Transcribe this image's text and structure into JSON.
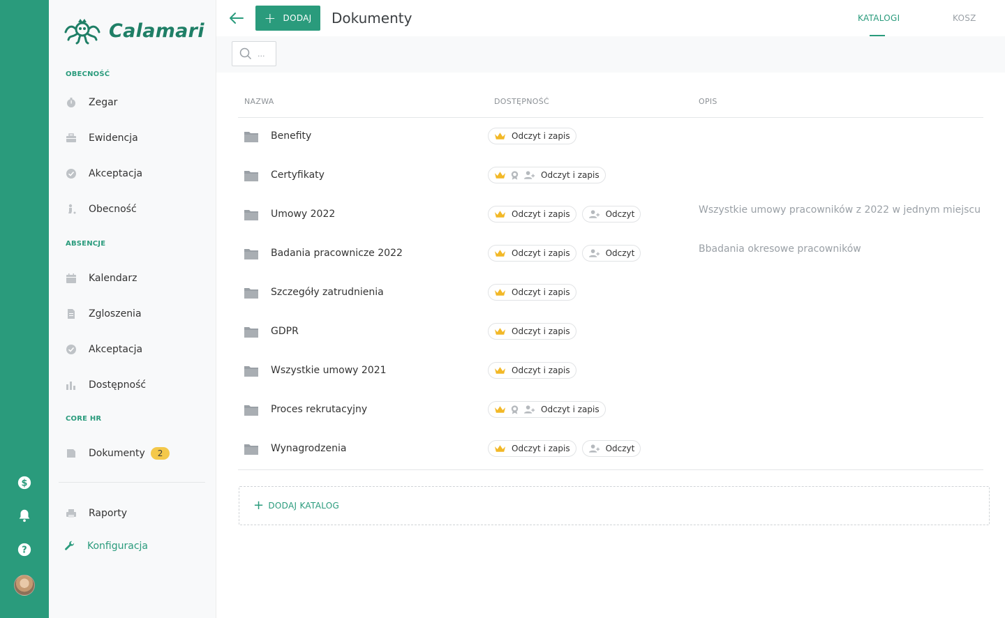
{
  "app": {
    "brand": "Calamari"
  },
  "colors": {
    "accent": "#2a9b7c",
    "badge": "#f4c84a",
    "crown": "#f2b827"
  },
  "rail": {
    "items": [
      {
        "icon": "dollar-icon"
      },
      {
        "icon": "bell-icon"
      },
      {
        "icon": "help-icon"
      },
      {
        "icon": "user-avatar"
      }
    ]
  },
  "sidebar": {
    "sections": {
      "obecnosc": "OBECNOŚĆ",
      "absencje": "ABSENCJE",
      "corehr": "CORE HR"
    },
    "items": {
      "zegar": "Zegar",
      "ewidencja": "Ewidencja",
      "akceptacja1": "Akceptacja",
      "obecnosc": "Obecność",
      "kalendarz": "Kalendarz",
      "zgloszenia": "Zgloszenia",
      "akceptacja2": "Akceptacja",
      "dostepnosc": "Dostępność",
      "dokumenty": "Dokumenty",
      "dokumenty_badge": "2",
      "raporty": "Raporty",
      "konfiguracja": "Konfiguracja"
    }
  },
  "header": {
    "add_label": "DODAJ",
    "title": "Dokumenty",
    "tabs": {
      "katalogi": "KATALOGI",
      "kosz": "KOSZ"
    },
    "active_tab": "KATALOGI"
  },
  "search": {
    "placeholder": "..."
  },
  "table": {
    "columns": {
      "name": "NAZWA",
      "access": "DOSTĘPNOŚĆ",
      "desc": "OPIS"
    },
    "rows": [
      {
        "name": "Benefity",
        "desc": "",
        "chips": [
          {
            "icons": [
              "crown"
            ],
            "label": "Odczyt i zapis"
          }
        ]
      },
      {
        "name": "Certyfikaty",
        "desc": "",
        "chips": [
          {
            "icons": [
              "crown",
              "badge",
              "users"
            ],
            "label": "Odczyt i zapis"
          }
        ]
      },
      {
        "name": "Umowy 2022",
        "desc": "Wszystkie umowy pracowników z 2022 w jednym miejscu",
        "chips": [
          {
            "icons": [
              "crown"
            ],
            "label": "Odczyt i zapis"
          },
          {
            "icons": [
              "users"
            ],
            "label": "Odczyt"
          }
        ]
      },
      {
        "name": "Badania pracownicze 2022",
        "desc": "Bbadania okresowe pracowników",
        "chips": [
          {
            "icons": [
              "crown"
            ],
            "label": "Odczyt i zapis"
          },
          {
            "icons": [
              "users"
            ],
            "label": "Odczyt"
          }
        ]
      },
      {
        "name": "Szczegóły zatrudnienia",
        "desc": "",
        "chips": [
          {
            "icons": [
              "crown"
            ],
            "label": "Odczyt i zapis"
          }
        ]
      },
      {
        "name": "GDPR",
        "desc": "",
        "chips": [
          {
            "icons": [
              "crown"
            ],
            "label": "Odczyt i zapis"
          }
        ]
      },
      {
        "name": "Wszystkie umowy 2021",
        "desc": "",
        "chips": [
          {
            "icons": [
              "crown"
            ],
            "label": "Odczyt i zapis"
          }
        ]
      },
      {
        "name": "Proces rekrutacyjny",
        "desc": "",
        "chips": [
          {
            "icons": [
              "crown",
              "badge",
              "users"
            ],
            "label": "Odczyt i zapis"
          }
        ]
      },
      {
        "name": "Wynagrodzenia",
        "desc": "",
        "chips": [
          {
            "icons": [
              "crown"
            ],
            "label": "Odczyt i zapis"
          },
          {
            "icons": [
              "users"
            ],
            "label": "Odczyt"
          }
        ]
      }
    ]
  },
  "footer": {
    "add_catalog": "DODAJ KATALOG"
  }
}
